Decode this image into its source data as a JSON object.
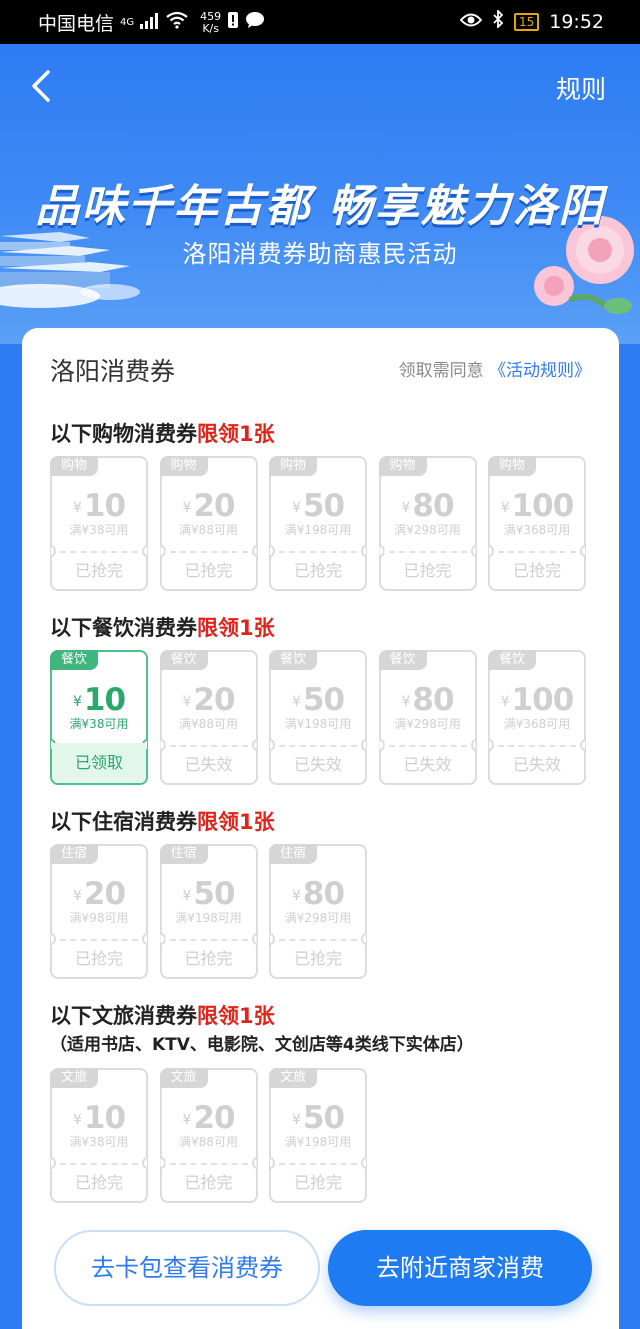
{
  "status_bar": {
    "carrier": "中国电信",
    "network": "4G",
    "speed_value": "459",
    "speed_unit": "K/s",
    "battery": "15",
    "time": "19:52"
  },
  "header": {
    "back_icon": "chevron-left-icon",
    "rules_label": "规则",
    "title": "品味千年古都 畅享魅力洛阳",
    "subtitle": "洛阳消费券助商惠民活动"
  },
  "card": {
    "title": "洛阳消费券",
    "note_prefix": "领取需同意",
    "note_link": "《活动规则》"
  },
  "sections": [
    {
      "title": "以下购物消费券",
      "limit": "限领1张",
      "subtitle": "",
      "coupons": [
        {
          "tag": "购物",
          "yen": "¥",
          "amount": "10",
          "condition": "满¥38可用",
          "status": "已抢完",
          "active": false
        },
        {
          "tag": "购物",
          "yen": "¥",
          "amount": "20",
          "condition": "满¥88可用",
          "status": "已抢完",
          "active": false
        },
        {
          "tag": "购物",
          "yen": "¥",
          "amount": "50",
          "condition": "满¥198可用",
          "status": "已抢完",
          "active": false
        },
        {
          "tag": "购物",
          "yen": "¥",
          "amount": "80",
          "condition": "满¥298可用",
          "status": "已抢完",
          "active": false
        },
        {
          "tag": "购物",
          "yen": "¥",
          "amount": "100",
          "condition": "满¥368可用",
          "status": "已抢完",
          "active": false
        }
      ]
    },
    {
      "title": "以下餐饮消费券",
      "limit": "限领1张",
      "subtitle": "",
      "coupons": [
        {
          "tag": "餐饮",
          "yen": "¥",
          "amount": "10",
          "condition": "满¥38可用",
          "status": "已领取",
          "active": true
        },
        {
          "tag": "餐饮",
          "yen": "¥",
          "amount": "20",
          "condition": "满¥88可用",
          "status": "已失效",
          "active": false
        },
        {
          "tag": "餐饮",
          "yen": "¥",
          "amount": "50",
          "condition": "满¥198可用",
          "status": "已失效",
          "active": false
        },
        {
          "tag": "餐饮",
          "yen": "¥",
          "amount": "80",
          "condition": "满¥298可用",
          "status": "已失效",
          "active": false
        },
        {
          "tag": "餐饮",
          "yen": "¥",
          "amount": "100",
          "condition": "满¥368可用",
          "status": "已失效",
          "active": false
        }
      ]
    },
    {
      "title": "以下住宿消费券",
      "limit": "限领1张",
      "subtitle": "",
      "coupons": [
        {
          "tag": "住宿",
          "yen": "¥",
          "amount": "20",
          "condition": "满¥98可用",
          "status": "已抢完",
          "active": false
        },
        {
          "tag": "住宿",
          "yen": "¥",
          "amount": "50",
          "condition": "满¥198可用",
          "status": "已抢完",
          "active": false
        },
        {
          "tag": "住宿",
          "yen": "¥",
          "amount": "80",
          "condition": "满¥298可用",
          "status": "已抢完",
          "active": false
        }
      ]
    },
    {
      "title": "以下文旅消费券",
      "limit": "限领1张",
      "subtitle": "（适用书店、KTV、电影院、文创店等4类线下实体店）",
      "coupons": [
        {
          "tag": "文旅",
          "yen": "¥",
          "amount": "10",
          "condition": "满¥38可用",
          "status": "已抢完",
          "active": false
        },
        {
          "tag": "文旅",
          "yen": "¥",
          "amount": "20",
          "condition": "满¥88可用",
          "status": "已抢完",
          "active": false
        },
        {
          "tag": "文旅",
          "yen": "¥",
          "amount": "50",
          "condition": "满¥198可用",
          "status": "已抢完",
          "active": false
        }
      ]
    }
  ],
  "buttons": {
    "wallet_label": "去卡包查看消费券",
    "nearby_label": "去附近商家消费"
  },
  "colors": {
    "brand_blue": "#2e7cf4",
    "limit_red": "#e2231a",
    "claimed_green": "#2aa86c"
  }
}
